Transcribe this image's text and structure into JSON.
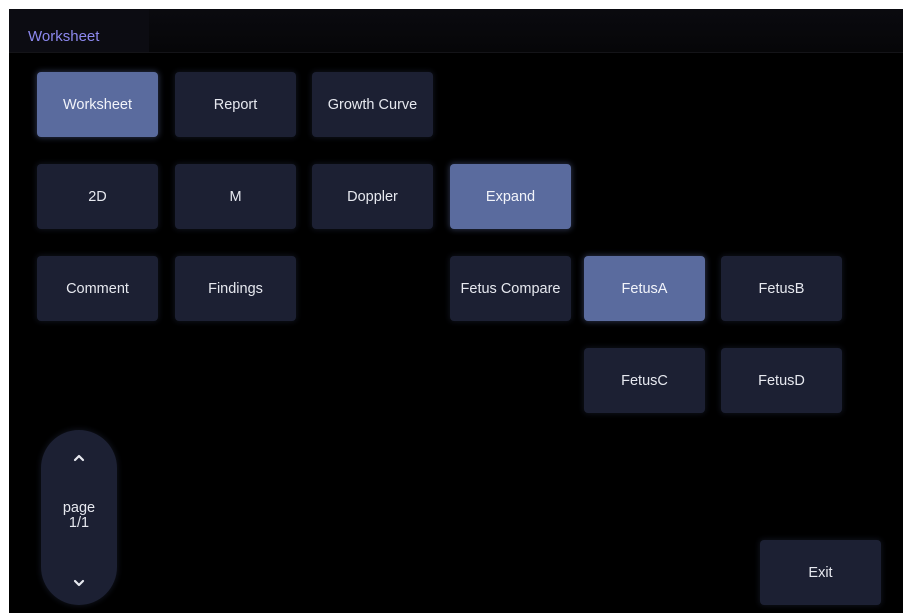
{
  "header": {
    "title": "Worksheet"
  },
  "nav_tabs": [
    {
      "label": "Worksheet",
      "active": true
    },
    {
      "label": "Report",
      "active": false
    },
    {
      "label": "Growth Curve",
      "active": false
    }
  ],
  "mode_buttons": [
    {
      "label": "2D",
      "active": false
    },
    {
      "label": "M",
      "active": false
    },
    {
      "label": "Doppler",
      "active": false
    },
    {
      "label": "Expand",
      "active": true
    }
  ],
  "actions": {
    "comment_label": "Comment",
    "findings_label": "Findings",
    "fetus_compare_label": "Fetus Compare",
    "exit_label": "Exit"
  },
  "fetus_buttons": [
    {
      "label": "FetusA",
      "active": true
    },
    {
      "label": "FetusB",
      "active": false
    },
    {
      "label": "FetusC",
      "active": false
    },
    {
      "label": "FetusD",
      "active": false
    }
  ],
  "pager": {
    "label": "page",
    "value": "1/1",
    "up_icon": "chevron-up-icon",
    "down_icon": "chevron-down-icon"
  },
  "colors": {
    "background": "#000000",
    "button": "#1c2033",
    "button_active": "#5a6b9e",
    "title_text": "#8c88ee",
    "button_text": "#e6e8ef"
  }
}
